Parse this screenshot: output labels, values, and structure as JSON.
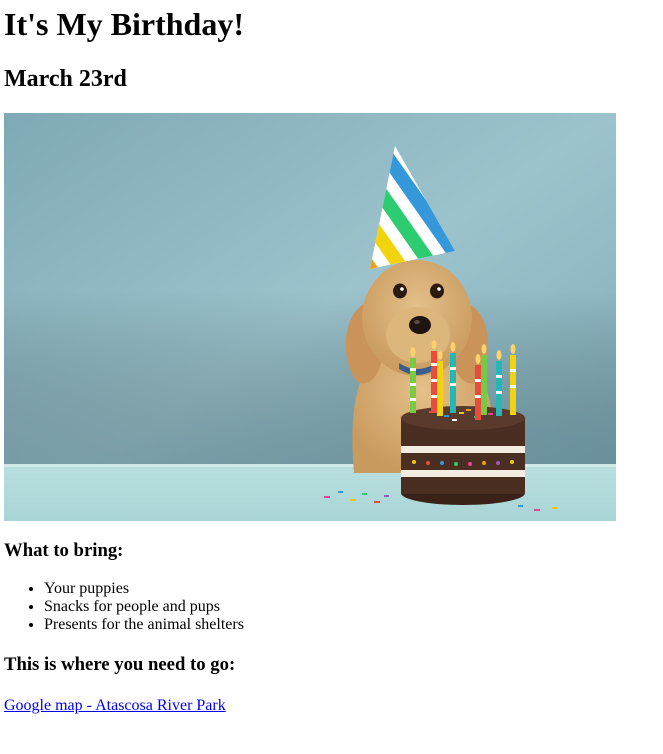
{
  "page": {
    "title": "It's My Birthday!",
    "date": "March 23rd"
  },
  "photo": {
    "subject": "dog-with-party-hat-and-birthday-cake"
  },
  "bring": {
    "heading": "What to bring:",
    "items": [
      "Your puppies",
      "Snacks for people and pups",
      "Presents for the animal shelters"
    ]
  },
  "location": {
    "heading": "This is where you need to go:",
    "link_text": "Google map - Atascosa River Park"
  },
  "colors": {
    "link": "#0000ee",
    "wall": "#8fb9c4",
    "table": "#b6dcdc",
    "cake": "#4a2e22"
  }
}
